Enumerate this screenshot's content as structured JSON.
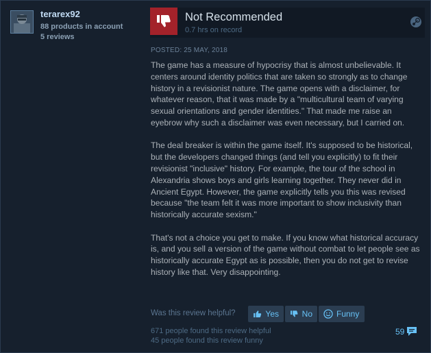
{
  "author": {
    "persona_name": "terarex92",
    "products": "88 products in account",
    "reviews": "5 reviews"
  },
  "vote": {
    "title": "Not Recommended",
    "hours": "0.7 hrs on record"
  },
  "review": {
    "posted": "POSTED: 25 MAY, 2018",
    "paragraphs": [
      "The game has a measure of hypocrisy that is almost unbelievable. It centers around identity politics that are taken so strongly as to change history in a revisionist nature. The game opens with a disclaimer, for whatever reason, that it was made by a \"multicultural team of varying sexual orientations and gender identities.\" That made me raise an eyebrow why such a disclaimer was even necessary, but I carried on.",
      "The deal breaker is within the game itself. It's supposed to be historical, but the developers changed things (and tell you explicitly) to fit their revisionist \"inclusive\" history. For example, the tour of the school in Alexandria shows boys and girls learning together. They never did in Ancient Egypt. However, the game explicitly tells you this was revised because \"the team felt it was more important to show inclusivity than historically accurate sexism.\"",
      "That's not a choice you get to make. If you know what historical accuracy is, and you sell a version of the game without combat to let people see as historically accurate Egypt as is possible, then you do not get to revise history like that. Very disappointing."
    ]
  },
  "controls": {
    "helpful_question": "Was this review helpful?",
    "yes_label": "Yes",
    "no_label": "No",
    "funny_label": "Funny"
  },
  "stats": {
    "helpful": "671 people found this review helpful",
    "funny": "45 people found this review funny",
    "comment_count": "59"
  },
  "colors": {
    "background": "#16202d",
    "not_recommended": "#a3222a",
    "link_blue": "#67c1f5"
  },
  "icons": {
    "thumb_down": "thumbs-down-icon",
    "platform": "steam-icon",
    "yes": "thumbs-up-icon",
    "no": "thumbs-down-icon",
    "funny": "smiley-icon",
    "comments": "comment-bubble-icon"
  }
}
